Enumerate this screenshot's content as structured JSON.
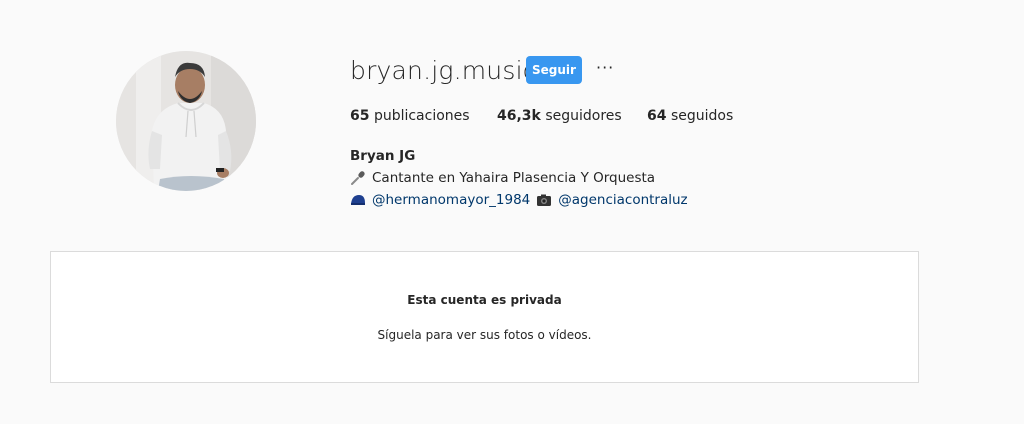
{
  "profile": {
    "username": "bryan.jg.music",
    "follow_label": "Seguir",
    "more_label": "···",
    "stats": {
      "posts_count": "65",
      "posts_label": "publicaciones",
      "followers_count": "46,3k",
      "followers_label": "seguidores",
      "following_count": "64",
      "following_label": "seguidos"
    },
    "bio": {
      "name": "Bryan JG",
      "line1_emoji": "microphone-icon",
      "line1_text": "Cantante en Yahaira Plasencia Y Orquesta",
      "line2_emoji": "cap-icon",
      "line2_link1": "@hermanomayor_1984",
      "line2_emoji2": "camera-icon",
      "line2_link2": "@agenciacontraluz"
    }
  },
  "private_notice": {
    "title": "Esta cuenta es privada",
    "subtitle": "Síguela para ver sus fotos o vídeos."
  },
  "colors": {
    "accent": "#3897f0",
    "link": "#00376b",
    "background": "#fafafa"
  }
}
